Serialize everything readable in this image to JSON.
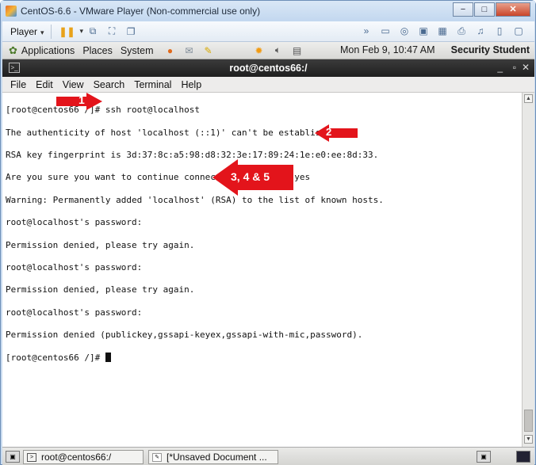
{
  "vm": {
    "title": "CentOS-6.6 - VMware Player (Non-commercial use only)",
    "min": "−",
    "max": "□",
    "close": "✕",
    "player_menu": "Player",
    "caret": "▾"
  },
  "gnome_panel": {
    "applications": "Applications",
    "places": "Places",
    "system": "System",
    "clock": "Mon Feb  9, 10:47 AM",
    "user": "Security Student"
  },
  "terminal": {
    "title": "root@centos66:/",
    "menu": [
      "File",
      "Edit",
      "View",
      "Search",
      "Terminal",
      "Help"
    ],
    "lines": [
      "[root@centos66 /]# ssh root@localhost",
      "The authenticity of host 'localhost (::1)' can't be established.",
      "RSA key fingerprint is 3d:37:8c:a5:98:d8:32:3e:17:89:24:1e:e0:ee:8d:33.",
      "Are you sure you want to continue connecting (yes/no)? yes",
      "Warning: Permanently added 'localhost' (RSA) to the list of known hosts.",
      "root@localhost's password:",
      "Permission denied, please try again.",
      "root@localhost's password:",
      "Permission denied, please try again.",
      "root@localhost's password:",
      "Permission denied (publickey,gssapi-keyex,gssapi-with-mic,password).",
      "[root@centos66 /]# "
    ]
  },
  "annotations": {
    "step1": "1",
    "step2": "2",
    "step3": "3, 4 & 5"
  },
  "taskbar": {
    "items": [
      "root@centos66:/",
      "[*Unsaved Document ..."
    ]
  },
  "colors": {
    "annotation_red": "#e3141b"
  }
}
